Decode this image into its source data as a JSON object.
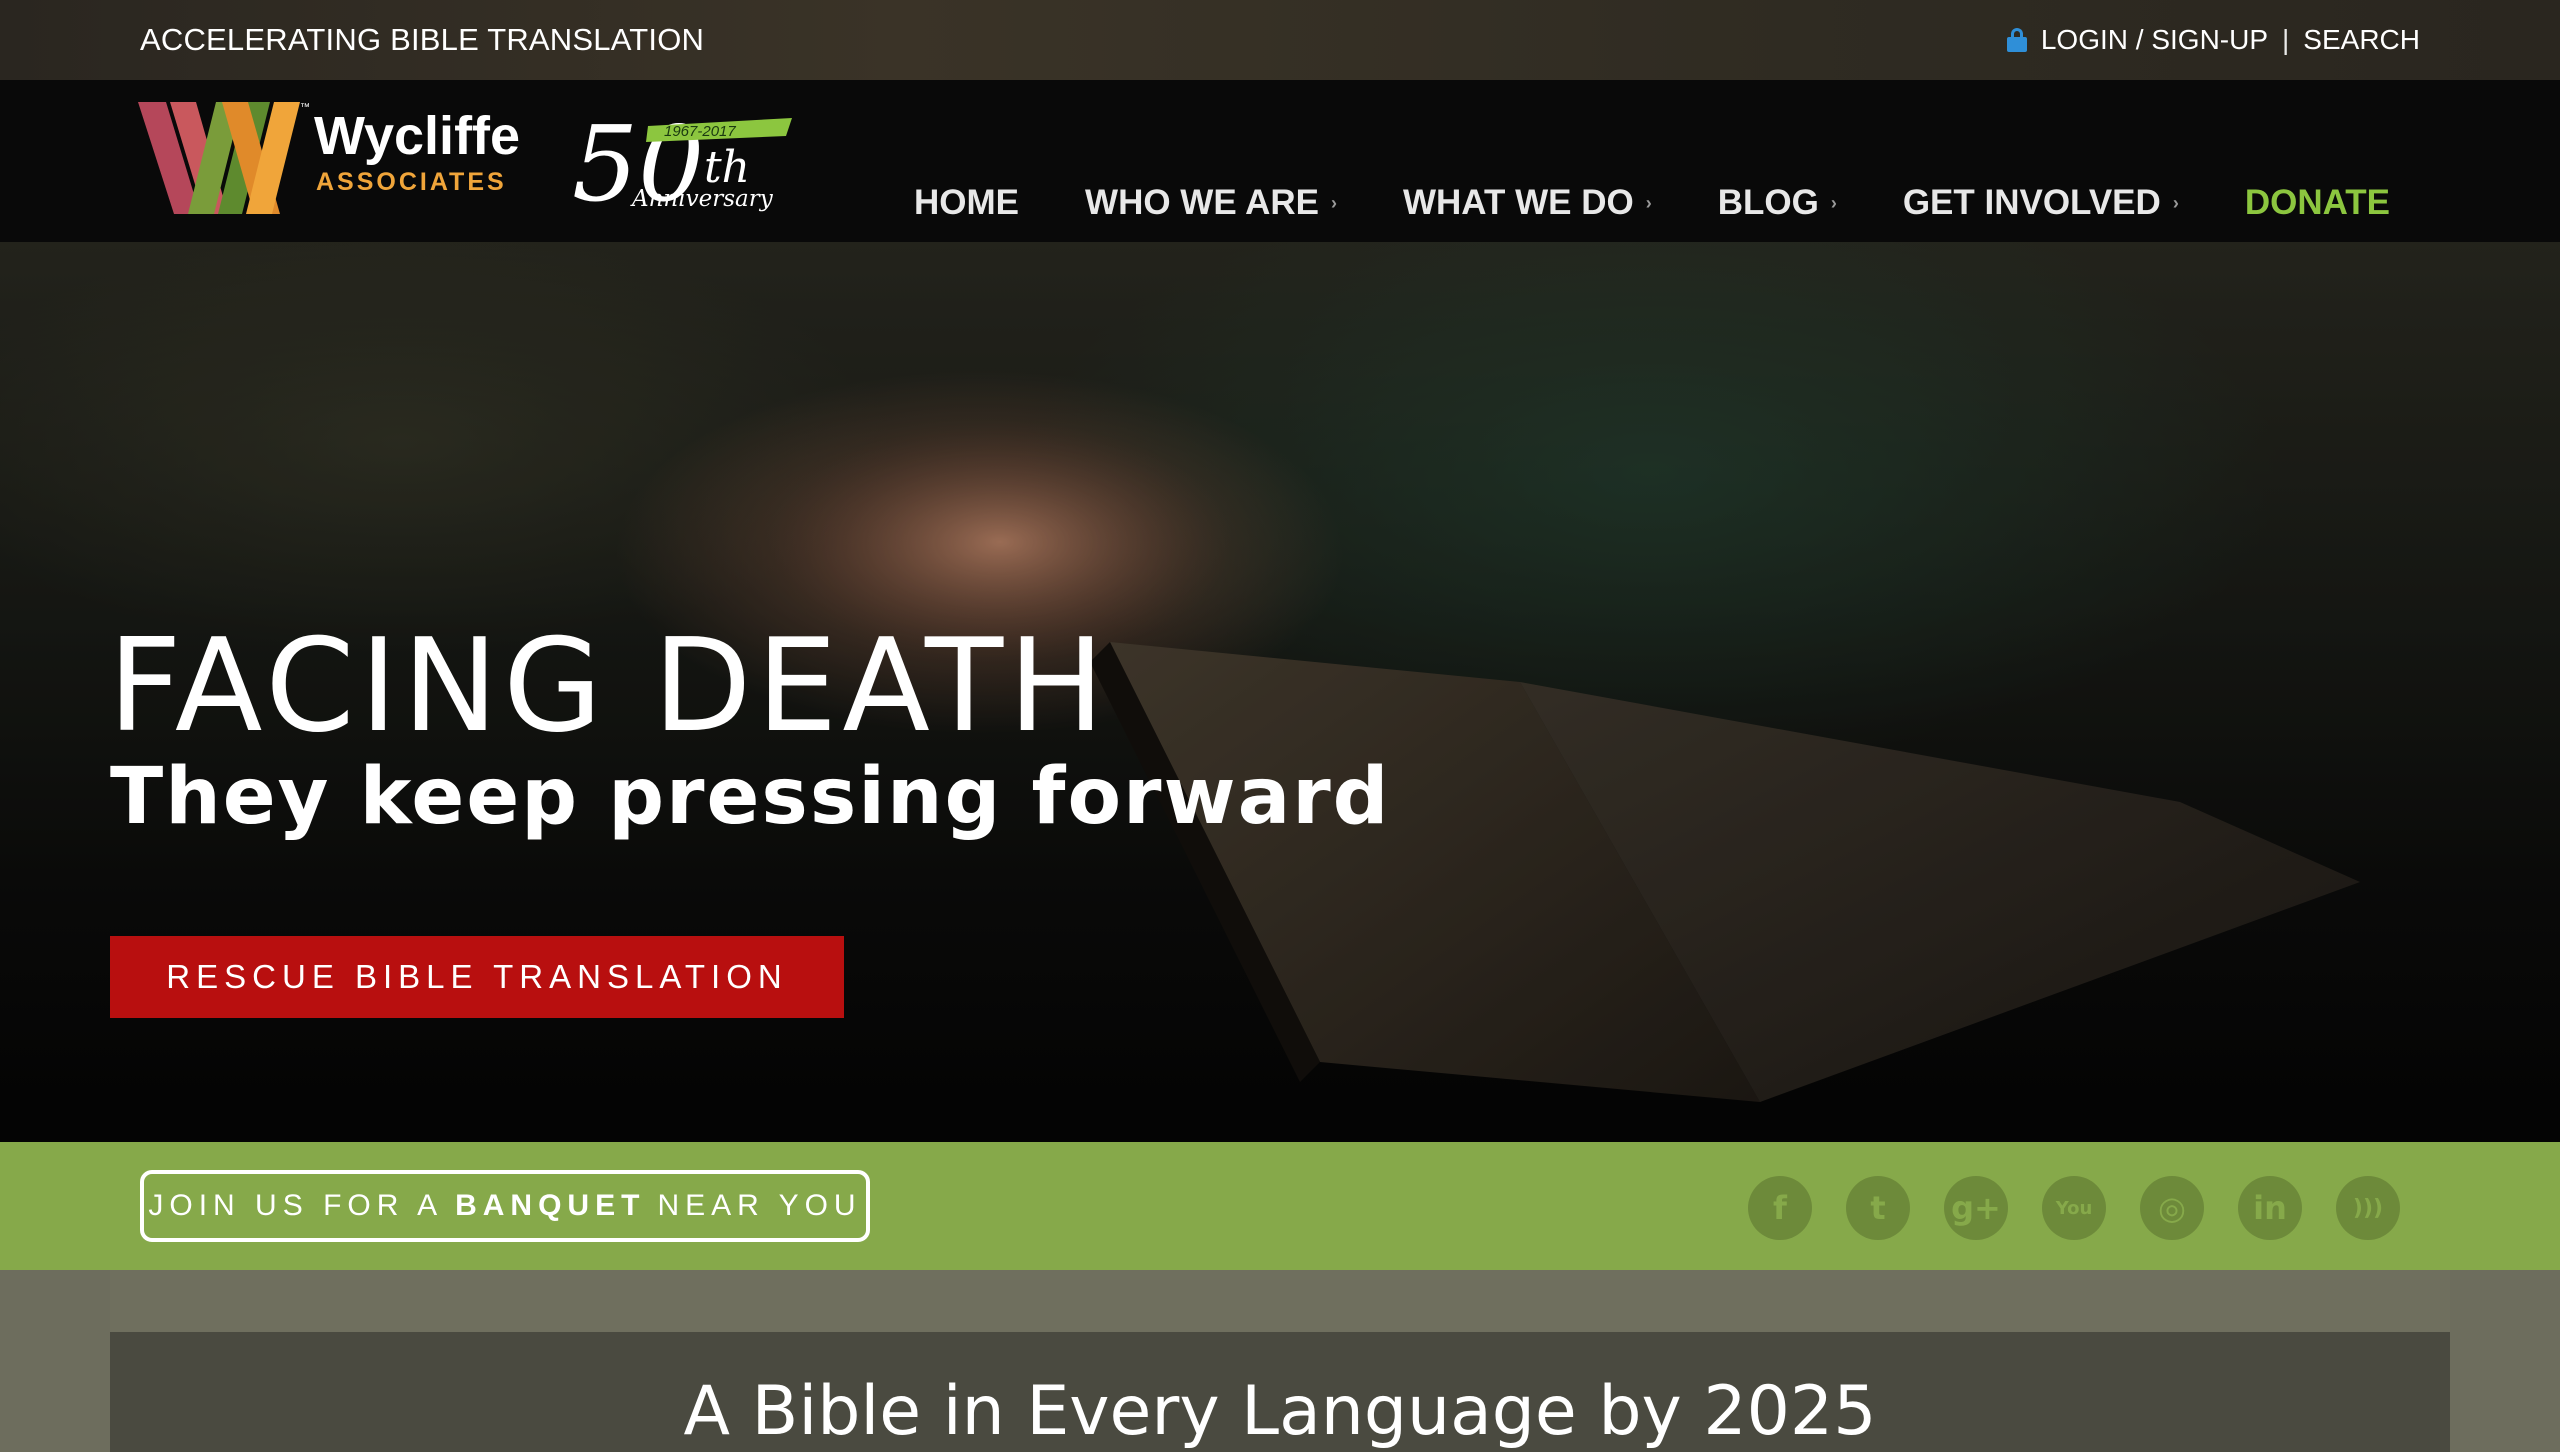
{
  "topbar": {
    "tagline": "ACCELERATING BIBLE TRANSLATION",
    "login": "LOGIN / SIGN-UP",
    "separator": "|",
    "search": "SEARCH"
  },
  "brand": {
    "name": "Wycliffe",
    "sub": "ASSOCIATES",
    "tm": "™",
    "anniv_num": "50",
    "anniv_th": "th",
    "anniv_years": "1967-2017",
    "anniv_word": "Anniversary"
  },
  "nav": {
    "home": "HOME",
    "who": "WHO WE ARE",
    "what": "WHAT WE DO",
    "blog": "BLOG",
    "involved": "GET INVOLVED",
    "donate": "DONATE",
    "chevron": "›"
  },
  "hero": {
    "title": "FACING DEATH",
    "subtitle": "They keep pressing forward",
    "button": "RESCUE BIBLE TRANSLATION"
  },
  "strip": {
    "banquet_pre": "JOIN US FOR A",
    "banquet_bold": "BANQUET",
    "banquet_post": "NEAR YOU",
    "social": [
      {
        "icon": "facebook-icon",
        "glyph": "f"
      },
      {
        "icon": "twitter-icon",
        "glyph": "t"
      },
      {
        "icon": "google-plus-icon",
        "glyph": "g+"
      },
      {
        "icon": "youtube-icon",
        "glyph": "You"
      },
      {
        "icon": "instagram-icon",
        "glyph": "◎"
      },
      {
        "icon": "linkedin-icon",
        "glyph": "in"
      },
      {
        "icon": "rss-icon",
        "glyph": ")))"
      }
    ]
  },
  "lower": {
    "title": "A Bible in Every Language by 2025"
  },
  "colors": {
    "accent_green": "#8cc63f",
    "strip_green": "#86a94a",
    "cta_red": "#b80f0f",
    "lock_blue": "#2f8fd8"
  }
}
